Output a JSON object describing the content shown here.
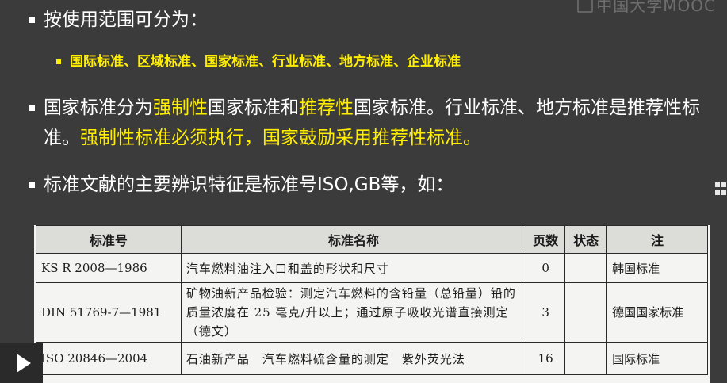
{
  "watermark": {
    "text": "中国大学MOOC"
  },
  "bullets": {
    "b1": "按使用范围可分为：",
    "sub": "国际标准、区域标准、国家标准、行业标准、地方标准、企业标准",
    "b2_parts": [
      "国家标准分为",
      "强制性",
      "国家标准和",
      "推荐性",
      "国家标准。行业标准、地方标准是推荐性标准。",
      "强制性标准必须执行，国家鼓励采用推荐性标准。"
    ],
    "b3": "标准文献的主要辨识特征是标准号ISO,GB等，如："
  },
  "table": {
    "headers": [
      "标准号",
      "标准名称",
      "页数",
      "状态",
      "注"
    ],
    "rows": [
      {
        "no": "KS R 2008—1986",
        "name": "汽车燃料油注入口和盖的形状和尺寸",
        "pages": "0",
        "status": "",
        "note": "韩国标准"
      },
      {
        "no": "DIN 51769-7—1981",
        "name": "矿物油新产品检验：测定汽车燃料的含铅量（总铅量）铅的质量浓度在 25 毫克/升以上；通过原子吸收光谱直接测定（德文）",
        "pages": "3",
        "status": "",
        "note": "德国国家标准"
      },
      {
        "no": "ISO 20846—2004",
        "name": "石油新产品　汽车燃料硫含量的测定　紫外荧光法",
        "pages": "16",
        "status": "",
        "note": "国际标准"
      }
    ]
  },
  "player": {
    "play_icon": "play-icon",
    "side_icon": "grid-icon"
  },
  "colors": {
    "background": "#3b3b3b",
    "highlight": "#ffee00",
    "text": "#ffffff"
  }
}
